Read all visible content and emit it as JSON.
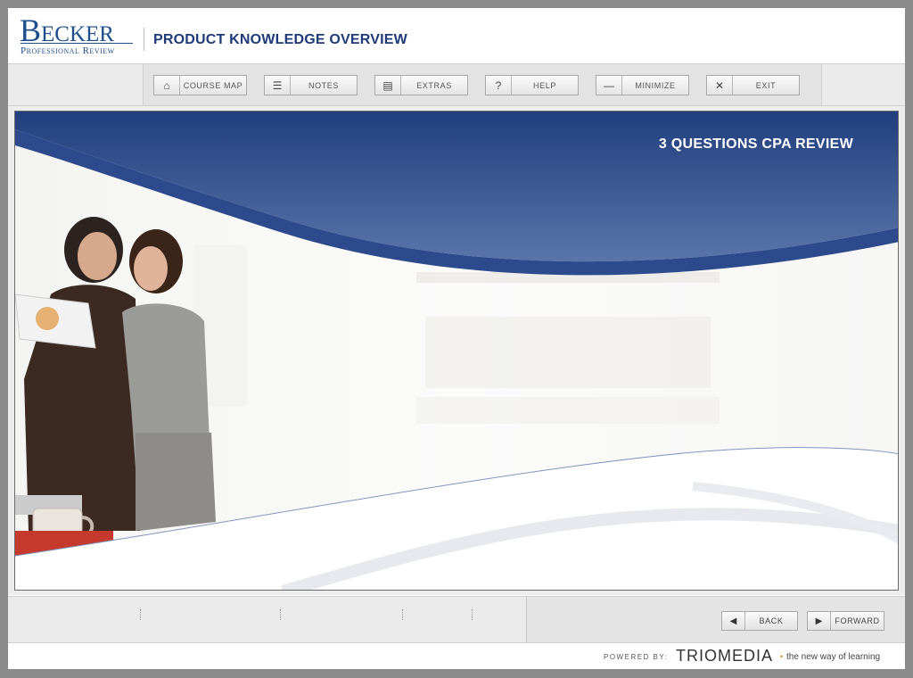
{
  "header": {
    "logo_main": "Becker",
    "logo_sub": "Professional Review",
    "title": "PRODUCT KNOWLEDGE OVERVIEW"
  },
  "toolbar": {
    "buttons": [
      {
        "label": "COURSE MAP",
        "icon": "home-icon",
        "glyph": "⌂"
      },
      {
        "label": "NOTES",
        "icon": "notes-icon",
        "glyph": "☰"
      },
      {
        "label": "EXTRAS",
        "icon": "extras-icon",
        "glyph": "▤"
      },
      {
        "label": "HELP",
        "icon": "help-icon",
        "glyph": "?"
      },
      {
        "label": "MINIMIZE",
        "icon": "minimize-icon",
        "glyph": "—"
      },
      {
        "label": "EXIT",
        "icon": "close-icon",
        "glyph": "✕"
      }
    ]
  },
  "stage": {
    "title": "3 QUESTIONS CPA REVIEW"
  },
  "nav": {
    "back_label": "BACK",
    "forward_label": "FORWARD",
    "back_glyph": "◀",
    "forward_glyph": "▶"
  },
  "footer": {
    "powered_label": "POWERED BY:",
    "brand": "TRIOMEDIA",
    "brand_dot": "•",
    "tagline": "the new way of learning"
  },
  "colors": {
    "brand_blue": "#1f4e8c",
    "banner_blue": "#2a4a8a",
    "accent_orange": "#e08a1a"
  }
}
